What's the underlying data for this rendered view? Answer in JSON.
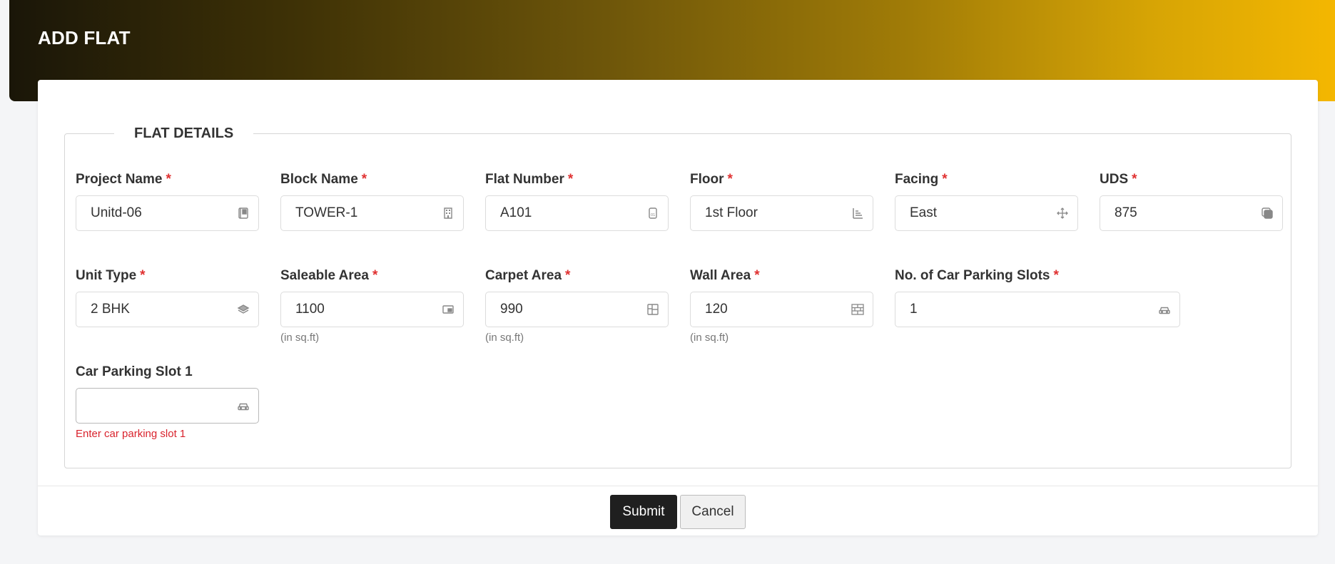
{
  "page": {
    "title": "ADD FLAT",
    "section_title": "FLAT DETAILS",
    "accent_dark": "#1a1608",
    "accent_gold": "#f4b701",
    "required_marker": "*"
  },
  "fields": {
    "project_name": {
      "label": "Project Name",
      "value": "Unitd-06",
      "icon": "book-icon"
    },
    "block_name": {
      "label": "Block Name",
      "value": "TOWER-1",
      "icon": "building-icon"
    },
    "flat_number": {
      "label": "Flat Number",
      "value": "A101",
      "icon": "door-number-icon"
    },
    "floor": {
      "label": "Floor",
      "value": "1st Floor",
      "icon": "floor-levels-icon"
    },
    "facing": {
      "label": "Facing",
      "value": "East",
      "icon": "compass-arrows-icon"
    },
    "uds": {
      "label": "UDS",
      "value": "875",
      "icon": "layers-square-icon"
    },
    "unit_type": {
      "label": "Unit Type",
      "value": "2 BHK",
      "icon": "stack-icon"
    },
    "saleable_area": {
      "label": "Saleable Area",
      "value": "1100",
      "hint": "(in sq.ft)",
      "icon": "picture-in-picture-icon"
    },
    "carpet_area": {
      "label": "Carpet Area",
      "value": "990",
      "hint": "(in sq.ft)",
      "icon": "layout-icon"
    },
    "wall_area": {
      "label": "Wall Area",
      "value": "120",
      "hint": "(in sq.ft)",
      "icon": "brick-wall-icon"
    },
    "car_parking_slots": {
      "label": "No. of Car Parking Slots",
      "value": "1",
      "icon": "car-icon"
    },
    "car_parking_slot_1": {
      "label": "Car Parking Slot 1",
      "value": "",
      "error": "Enter car parking slot 1",
      "icon": "car-icon"
    }
  },
  "actions": {
    "submit_label": "Submit",
    "cancel_label": "Cancel"
  }
}
